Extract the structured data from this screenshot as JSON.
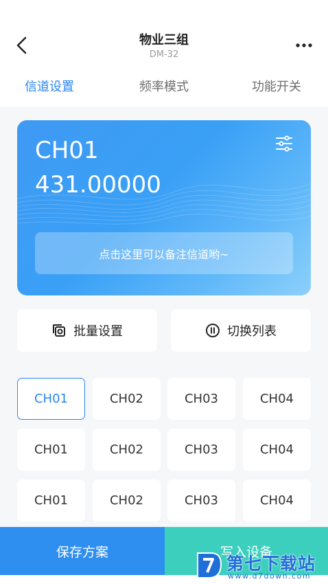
{
  "header": {
    "title": "物业三组",
    "subtitle": "DM-32",
    "back_icon": "chevron-left-icon",
    "more_icon": "more-horizontal-icon"
  },
  "tabs": [
    {
      "label": "信道设置",
      "active": true
    },
    {
      "label": "频率模式",
      "active": false
    },
    {
      "label": "功能开关",
      "active": false
    }
  ],
  "channel_card": {
    "channel": "CH01",
    "frequency": "431.00000",
    "note_placeholder": "点击这里可以备注信道哟~",
    "settings_icon": "sliders-icon"
  },
  "actions": {
    "batch_label": "批量设置",
    "batch_icon": "copy-icon",
    "switch_label": "切换列表",
    "switch_icon": "switch-circle-icon"
  },
  "channels": [
    {
      "label": "CH01",
      "selected": true
    },
    {
      "label": "CH02",
      "selected": false
    },
    {
      "label": "CH03",
      "selected": false
    },
    {
      "label": "CH04",
      "selected": false
    },
    {
      "label": "CH01",
      "selected": false
    },
    {
      "label": "CH02",
      "selected": false
    },
    {
      "label": "CH03",
      "selected": false
    },
    {
      "label": "CH04",
      "selected": false
    },
    {
      "label": "CH01",
      "selected": false
    },
    {
      "label": "CH02",
      "selected": false
    },
    {
      "label": "CH03",
      "selected": false
    },
    {
      "label": "CH04",
      "selected": false
    }
  ],
  "bottom": {
    "save_label": "保存方案",
    "write_label": "写入设备"
  },
  "watermark": {
    "text": "第七下载站",
    "url": "www.d7down.com"
  },
  "colors": {
    "accent": "#2b86f0",
    "save_button": "#2f8ff0",
    "write_button": "#3ccfbe"
  }
}
